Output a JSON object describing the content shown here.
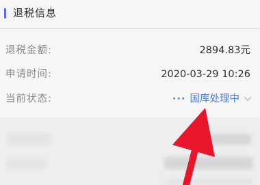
{
  "section": {
    "title": "退税信息"
  },
  "rows": [
    {
      "label": "退税金额:",
      "value": "2894.83元"
    },
    {
      "label": "申请时间:",
      "value": "2020-03-29 10:26"
    },
    {
      "label": "当前状态:",
      "value": "国库处理中",
      "dots": "···"
    }
  ],
  "colors": {
    "accent": "#5b6cf4",
    "status": "#4a7bd6",
    "arrow": "#e8162b"
  },
  "icons": [
    "dots-icon",
    "chevron-down-icon",
    "red-arrow-annotation"
  ]
}
